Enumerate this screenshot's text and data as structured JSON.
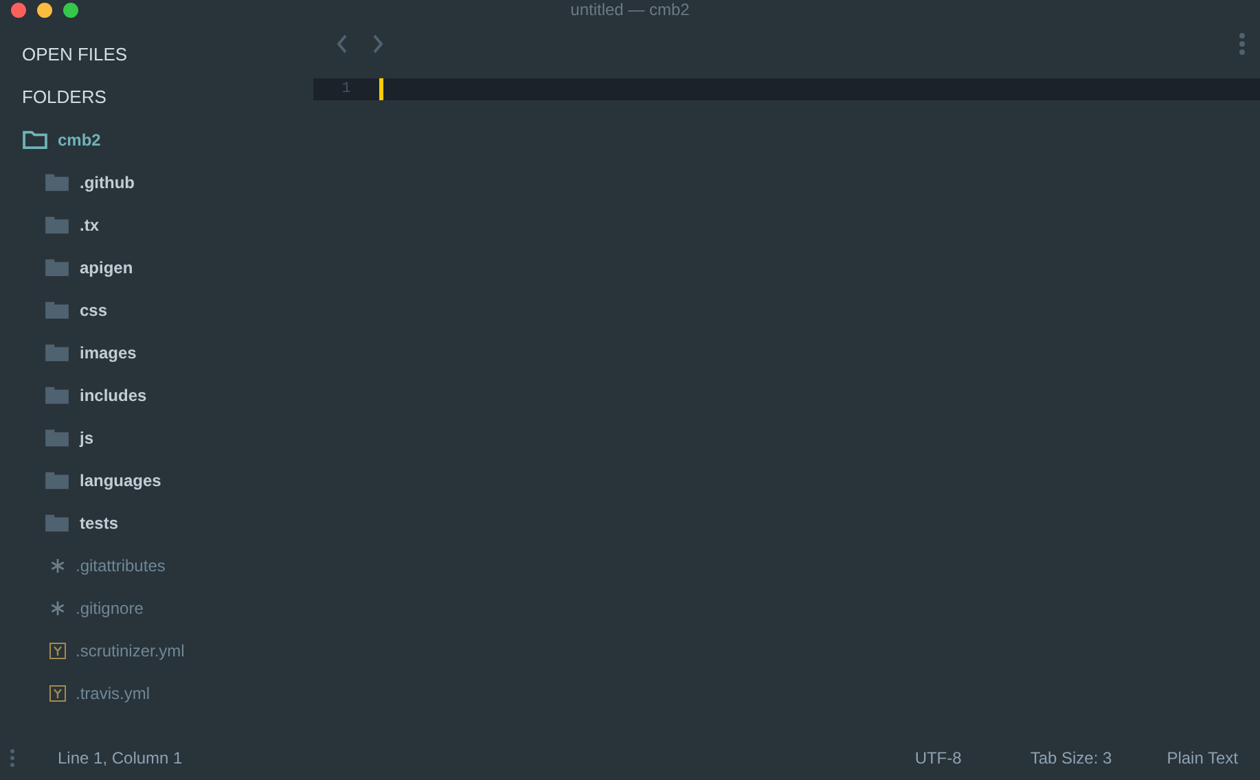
{
  "window": {
    "title": "untitled — cmb2"
  },
  "sidebar": {
    "sections": [
      "OPEN FILES",
      "FOLDERS"
    ],
    "tree": [
      {
        "name": "cmb2",
        "kind": "folder",
        "expanded": true,
        "children": [
          {
            "name": ".github",
            "kind": "folder",
            "expanded": false
          },
          {
            "name": ".tx",
            "kind": "folder",
            "expanded": false
          },
          {
            "name": "apigen",
            "kind": "folder",
            "expanded": false
          },
          {
            "name": "css",
            "kind": "folder",
            "expanded": false
          },
          {
            "name": "images",
            "kind": "folder",
            "expanded": false
          },
          {
            "name": "includes",
            "kind": "folder",
            "expanded": false
          },
          {
            "name": "js",
            "kind": "folder",
            "expanded": false
          },
          {
            "name": "languages",
            "kind": "folder",
            "expanded": false
          },
          {
            "name": "tests",
            "kind": "folder",
            "expanded": false
          },
          {
            "name": ".gitattributes",
            "kind": "config"
          },
          {
            "name": ".gitignore",
            "kind": "config"
          },
          {
            "name": ".scrutinizer.yml",
            "kind": "yaml"
          },
          {
            "name": ".travis.yml",
            "kind": "yaml"
          }
        ]
      }
    ]
  },
  "editor": {
    "lines": [
      {
        "number": "1",
        "current": true
      }
    ]
  },
  "status_bar": {
    "position": "Line 1, Column 1",
    "encoding": "UTF-8",
    "tab_size": "Tab Size: 3",
    "syntax": "Plain Text"
  }
}
